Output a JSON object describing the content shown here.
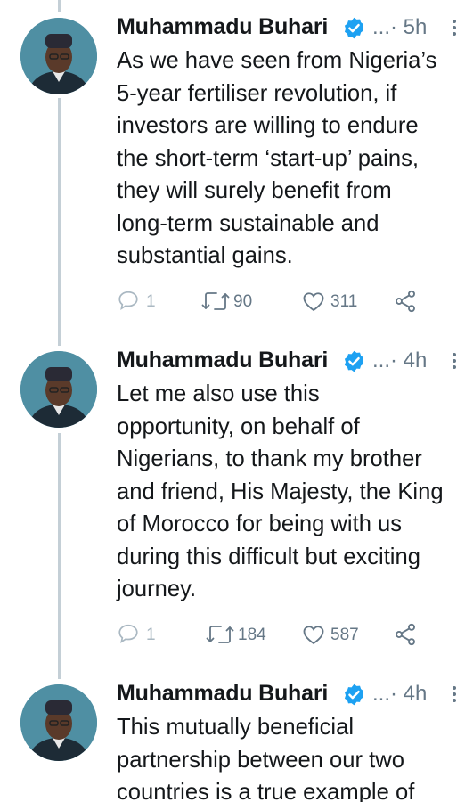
{
  "tweets": [
    {
      "author": "Muhammadu Buhari",
      "ellipsis": "...·",
      "time": "5h",
      "text": "As we have seen from Nigeria’s\n5-year fertiliser revolution, if\ninvestors are willing to endure\nthe short-term ‘start-up’ pains,\nthey will surely benefit from\nlong-term sustainable and\nsubstantial gains.",
      "replies": "1",
      "retweets": "90",
      "likes": "311"
    },
    {
      "author": "Muhammadu Buhari",
      "ellipsis": "...·",
      "time": "4h",
      "text": "Let me also use this\nopportunity, on behalf of\nNigerians, to thank my brother\nand friend, His Majesty, the King\nof Morocco for being with us\nduring this difficult but exciting\njourney.",
      "replies": "1",
      "retweets": "184",
      "likes": "587"
    },
    {
      "author": "Muhammadu Buhari",
      "ellipsis": "...·",
      "time": "4h",
      "text": "This mutually beneficial\npartnership between our two\ncountries is a true example of",
      "replies": "",
      "retweets": "",
      "likes": ""
    }
  ],
  "icons": {
    "verified": "verified-badge-icon",
    "more": "more-vertical-icon",
    "reply": "reply-icon",
    "retweet": "retweet-icon",
    "like": "heart-icon",
    "share": "share-icon"
  },
  "colors": {
    "verified": "#1da1f2",
    "muted": "#657786",
    "reply_muted": "#aab8c2",
    "thread_line": "#c4cfd6"
  }
}
